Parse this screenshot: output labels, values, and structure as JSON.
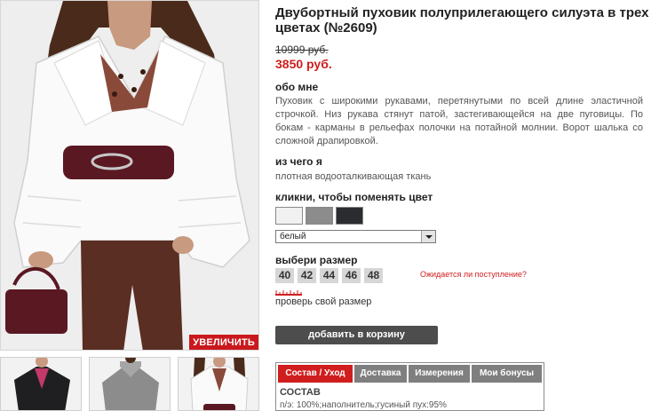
{
  "product": {
    "title": "Двубортный пуховик полуприлегающего силуэта в трех цветах (№2609)",
    "old_price": "10999 руб.",
    "new_price": "3850 руб."
  },
  "gallery": {
    "zoom_label": "УВЕЛИЧИТЬ"
  },
  "about": {
    "heading": "обо мне",
    "text": "Пуховик с широкими рукавами, перетянутыми по всей длине эластичной строчкой. Низ рукава стянут патой, застегивающейся на две пуговицы. По бокам - карманы в рельефах полочки на потайной молнии. Ворот шалька со сложной драпировкой."
  },
  "material": {
    "heading": "из чего я",
    "text": "плотная водооталкивающая ткань"
  },
  "color": {
    "heading": "кликни, чтобы поменять цвет",
    "swatches": [
      "#f1f1f1",
      "#8c8c8c",
      "#2a2c30"
    ],
    "selected": "белый"
  },
  "size": {
    "heading": "выбери размер",
    "options": [
      "40",
      "42",
      "44",
      "46",
      "48"
    ],
    "awaited_link": "Ожидается ли поступление?",
    "check_link": "проверь свой размер"
  },
  "cart": {
    "button_label": "добавить в корзину"
  },
  "tabs": {
    "items": [
      "Состав / Уход",
      "Доставка",
      "Измерения",
      "Мои бонусы"
    ],
    "active_index": 0,
    "content_title": "СОСТАВ",
    "content_text": "п/э: 100%;наполнитель;гусиный пух:95%"
  },
  "colors": {
    "accent_red": "#d01e1e",
    "zoom_red": "#c9191e",
    "dark_button": "#4d4d4d",
    "tab_grey": "#7f7f7f"
  }
}
